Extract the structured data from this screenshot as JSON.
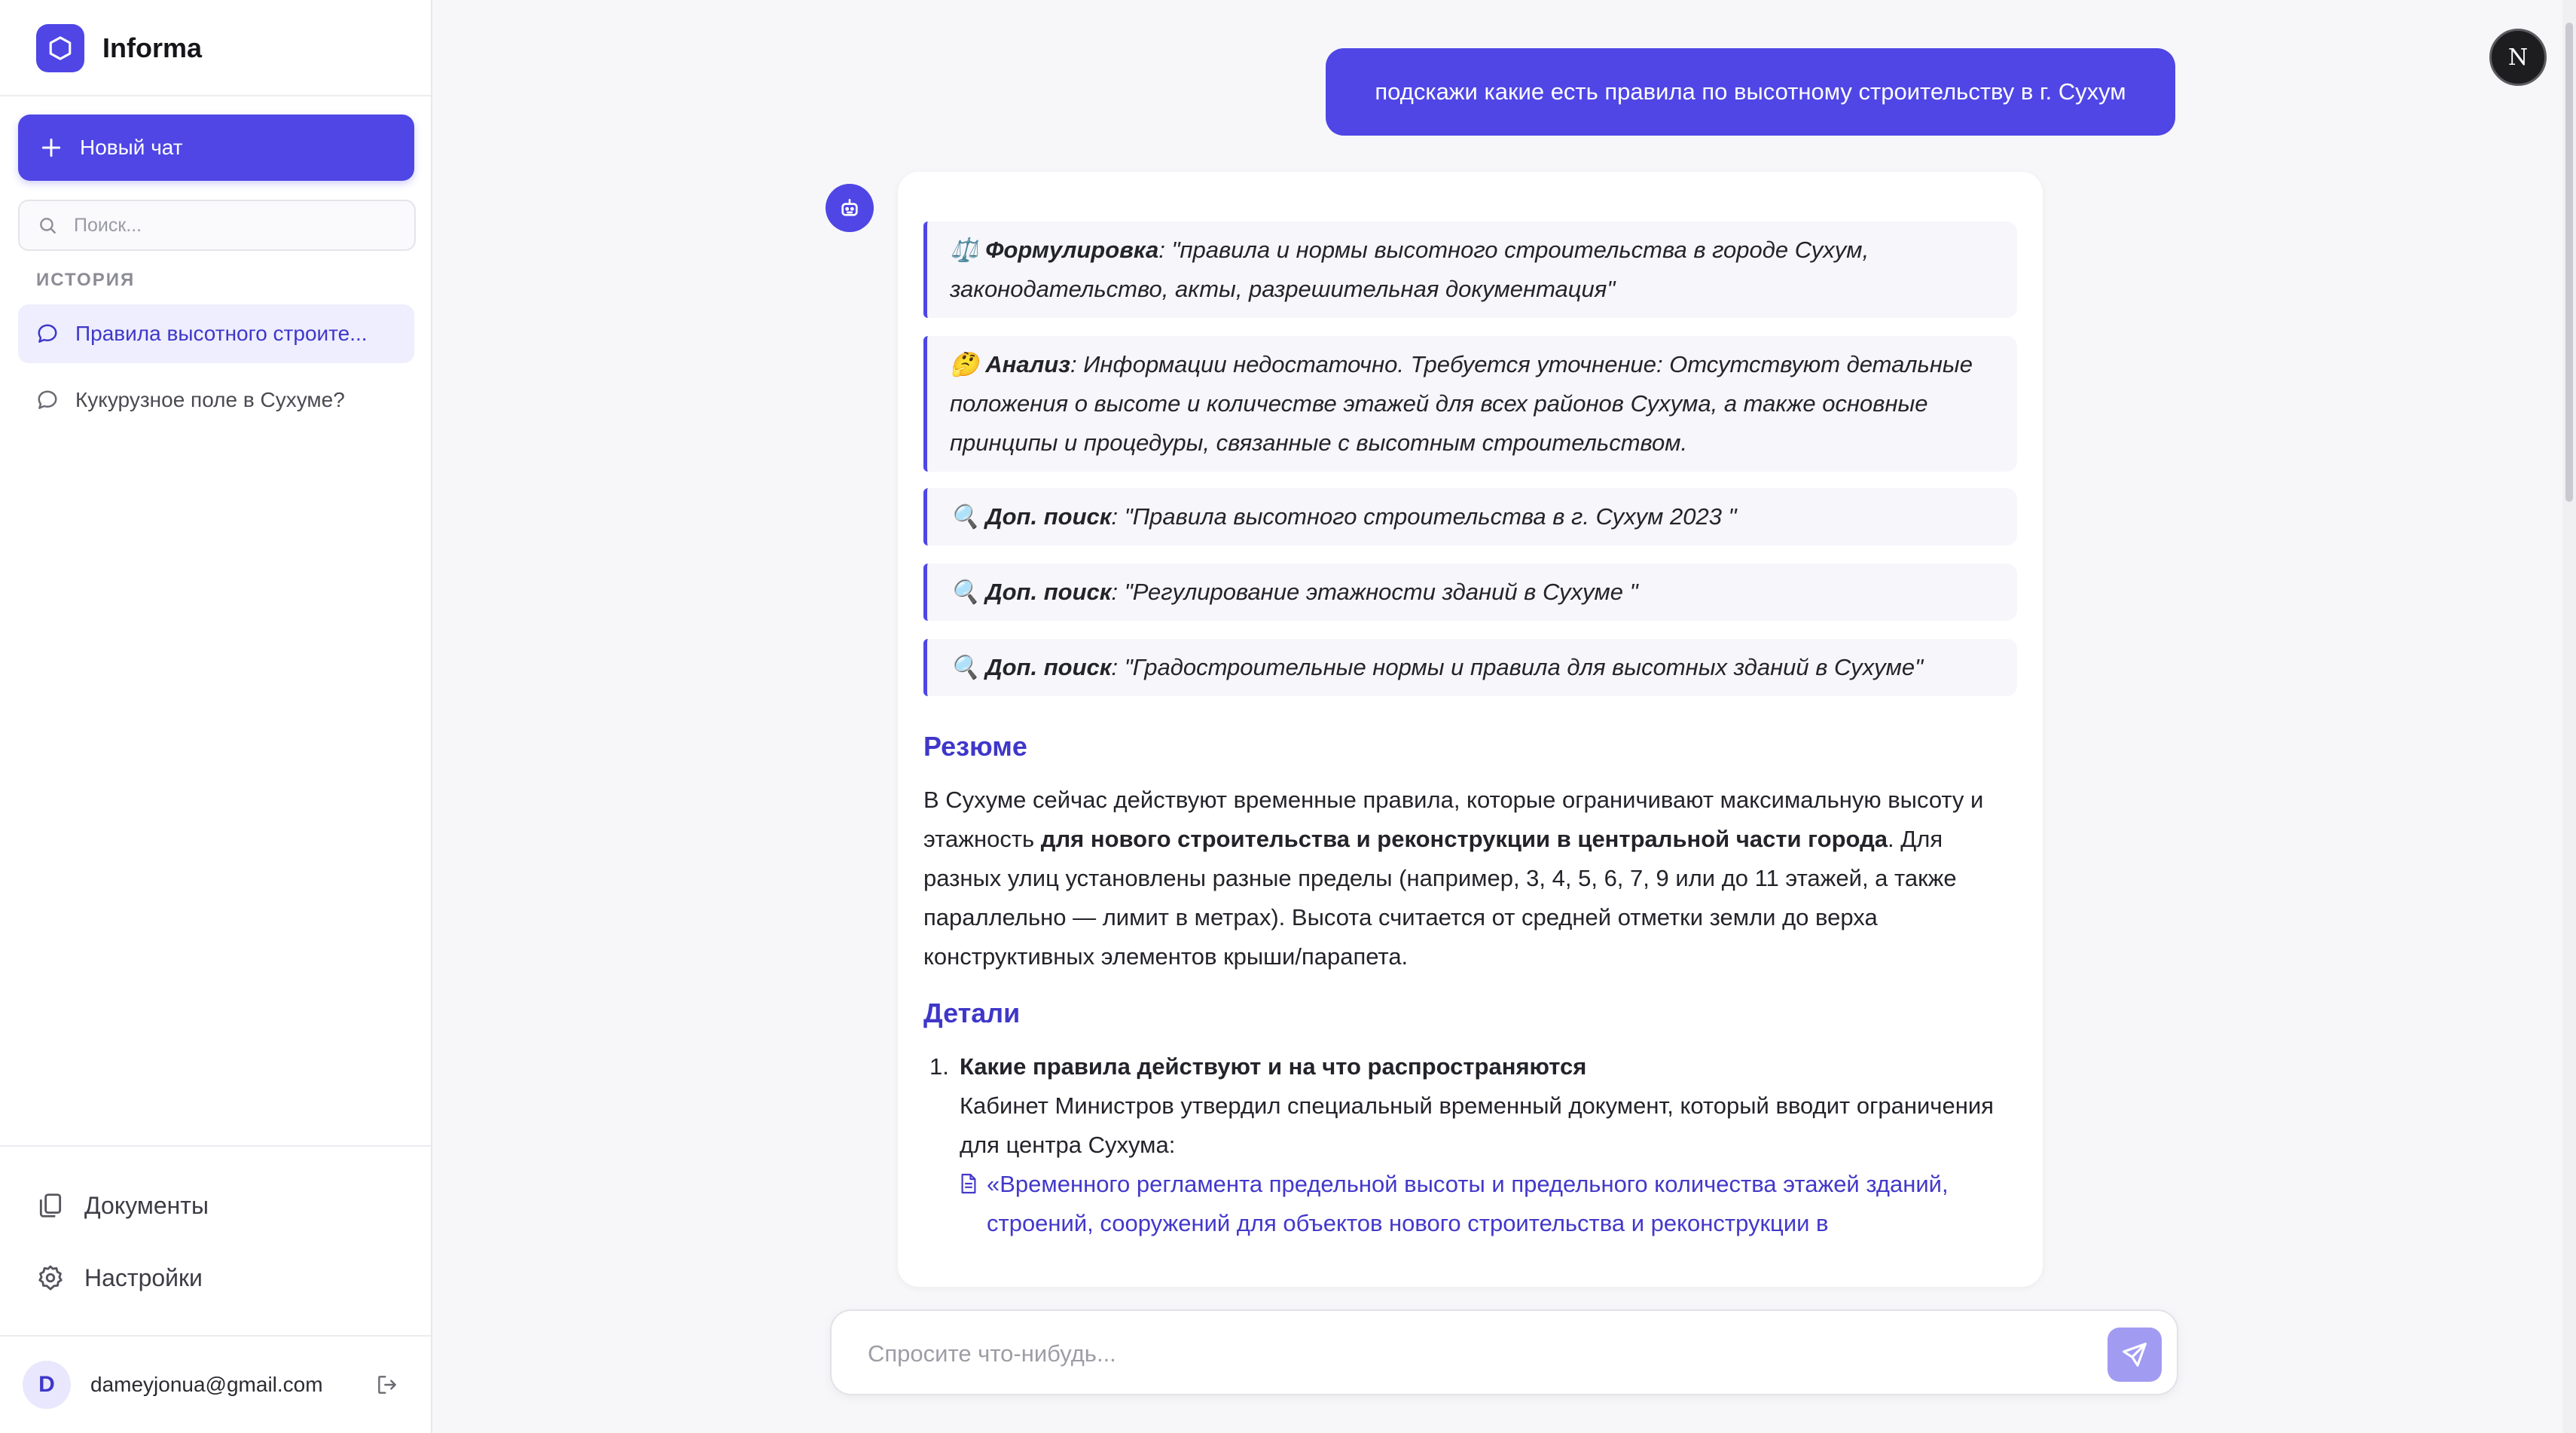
{
  "app": {
    "name": "Informa",
    "brand_color": "#4f46e5"
  },
  "sidebar": {
    "new_chat_label": "Новый чат",
    "search_placeholder": "Поиск...",
    "history_label": "ИСТОРИЯ",
    "history": [
      {
        "label": "Правила высотного строите...",
        "active": true
      },
      {
        "label": "Кукурузное поле в Сухуме?",
        "active": false
      }
    ],
    "links": [
      {
        "label": "Документы",
        "icon": "documents-icon"
      },
      {
        "label": "Настройки",
        "icon": "gear-icon"
      }
    ],
    "user": {
      "initial": "D",
      "email": "dameyjonua@gmail.com"
    }
  },
  "header": {
    "badge": "N"
  },
  "chat": {
    "user_message": "подскажи какие есть правила по высотному строительству в г. Сухум",
    "answer": {
      "quotes": [
        {
          "emoji": "⚖️",
          "title": "Формулировка",
          "text": ": \"правила и нормы высотного строительства в городе Сухум, законодательство, акты, разрешительная документация\""
        },
        {
          "emoji": "🤔",
          "title": "Анализ",
          "text": ": Информации недостаточно. Требуется уточнение: Отсутствуют детальные положения о высоте и количестве этажей для всех районов Сухума, а также основные принципы и процедуры, связанные с высотным строительством."
        },
        {
          "emoji": "🔍",
          "title": "Доп. поиск",
          "text": ": \"Правила высотного строительства в г. Сухум 2023 \""
        },
        {
          "emoji": "🔍",
          "title": "Доп. поиск",
          "text": ": \"Регулирование этажности зданий в Сухуме \""
        },
        {
          "emoji": "🔍",
          "title": "Доп. поиск",
          "text": ": \"Градостроительные нормы и правила для высотных зданий в Сухуме\""
        }
      ],
      "summary_heading": "Резюме",
      "summary": {
        "p1": "В Сухуме сейчас действуют временные правила, которые ограничивают максимальную высоту и этажность ",
        "bold": "для нового строительства и реконструкции в центральной части города",
        "p2": ". Для разных улиц установлены разные пределы (например, 3, 4, 5, 6, 7, 9 или до 11 этажей, а также параллельно — лимит в метрах). Высота считается от средней отметки земли до верха конструктивных элементов крыши/парапета."
      },
      "details_heading": "Детали",
      "details": [
        {
          "num": "1.",
          "title": "Какие правила действуют и на что распространяются",
          "text": "Кабинет Министров утвердил специальный временный документ, который вводит ограничения для центра Сухума:",
          "link": "«Временного регламента предельной высоты и предельного количества этажей зданий, строений, сооружений для объектов нового строительства и реконструкции в"
        }
      ]
    }
  },
  "composer": {
    "placeholder": "Спросите что-нибудь..."
  }
}
